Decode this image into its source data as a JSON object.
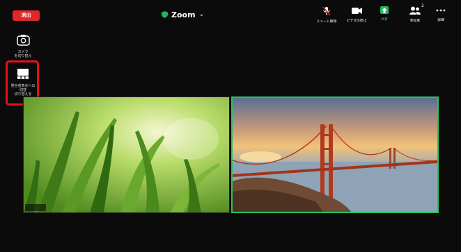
{
  "topbar": {
    "leave_label": "退出",
    "title": "Zoom",
    "items": [
      {
        "label": "ミュート解除",
        "icon": "mic-muted-icon"
      },
      {
        "label": "ビデオの停止",
        "icon": "video-camera-icon"
      },
      {
        "label": "共有",
        "icon": "share-screen-icon"
      },
      {
        "label": "参加者",
        "icon": "participants-icon",
        "count": "2"
      },
      {
        "label": "詳細",
        "icon": "more-icon"
      }
    ]
  },
  "sidebar": {
    "camera_switch_label": "カメラ\nを切り替え",
    "speaker_view_label": "発言者表示への\n切替\n切り替える"
  },
  "colors": {
    "leave": "#e02828",
    "share": "#1fb85b",
    "active_speaker_border": "#23c55e",
    "highlight": "#e4121b"
  }
}
